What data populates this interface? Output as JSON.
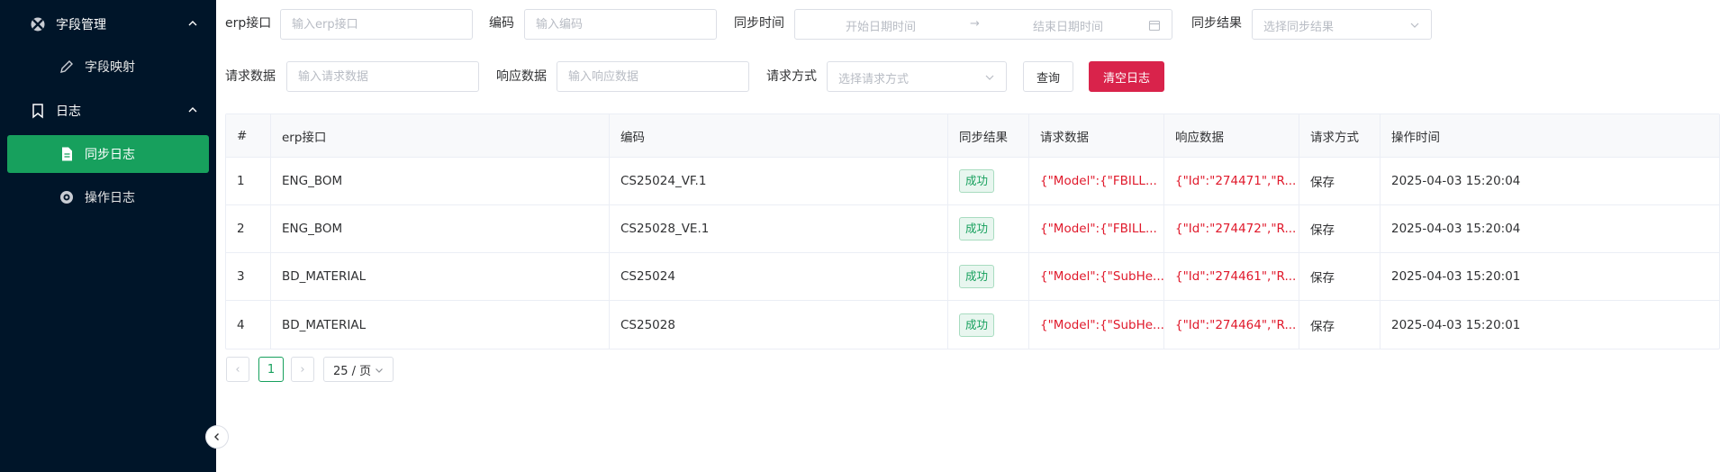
{
  "sidebar": {
    "groups": [
      {
        "label": "字段管理",
        "icon": "xbox-icon"
      },
      {
        "label": "日志",
        "icon": "bookmark-icon"
      }
    ],
    "items": [
      {
        "label": "字段映射",
        "icon": "pen-icon"
      },
      {
        "label": "同步日志",
        "icon": "document-icon"
      },
      {
        "label": "操作日志",
        "icon": "eye-icon"
      }
    ]
  },
  "filters": {
    "erp": {
      "label": "erp接口",
      "placeholder": "输入erp接口"
    },
    "code": {
      "label": "编码",
      "placeholder": "输入编码"
    },
    "sync_time": {
      "label": "同步时间",
      "start_placeholder": "开始日期时间",
      "separator": "→",
      "end_placeholder": "结束日期时间"
    },
    "sync_result": {
      "label": "同步结果",
      "placeholder": "选择同步结果"
    },
    "request": {
      "label": "请求数据",
      "placeholder": "输入请求数据"
    },
    "response": {
      "label": "响应数据",
      "placeholder": "输入响应数据"
    },
    "method": {
      "label": "请求方式",
      "placeholder": "选择请求方式"
    },
    "query_button": "查询",
    "clear_button": "清空日志"
  },
  "table": {
    "headers": [
      "#",
      "erp接口",
      "编码",
      "同步结果",
      "请求数据",
      "响应数据",
      "请求方式",
      "操作时间"
    ],
    "rows": [
      {
        "idx": "1",
        "erp": "ENG_BOM",
        "code": "CS25024_VF.1",
        "result": "成功",
        "request": "{\"Model\":{\"FBILL...",
        "response": "{\"Id\":\"274471\",\"R...",
        "method": "保存",
        "time": "2025-04-03 15:20:04"
      },
      {
        "idx": "2",
        "erp": "ENG_BOM",
        "code": "CS25028_VE.1",
        "result": "成功",
        "request": "{\"Model\":{\"FBILL...",
        "response": "{\"Id\":\"274472\",\"R...",
        "method": "保存",
        "time": "2025-04-03 15:20:04"
      },
      {
        "idx": "3",
        "erp": "BD_MATERIAL",
        "code": "CS25024",
        "result": "成功",
        "request": "{\"Model\":{\"SubHe...",
        "response": "{\"Id\":\"274461\",\"R...",
        "method": "保存",
        "time": "2025-04-03 15:20:01"
      },
      {
        "idx": "4",
        "erp": "BD_MATERIAL",
        "code": "CS25028",
        "result": "成功",
        "request": "{\"Model\":{\"SubHe...",
        "response": "{\"Id\":\"274464\",\"R...",
        "method": "保存",
        "time": "2025-04-03 15:20:01"
      }
    ]
  },
  "pagination": {
    "prev": "‹",
    "current_page": "1",
    "next": "›",
    "page_size": "25 / 页"
  },
  "colors": {
    "sidebar_bg": "#001529",
    "active_bg": "#17a05d",
    "danger": "#d9234b",
    "success_text": "#17a05d",
    "red_text": "#e0192b"
  }
}
